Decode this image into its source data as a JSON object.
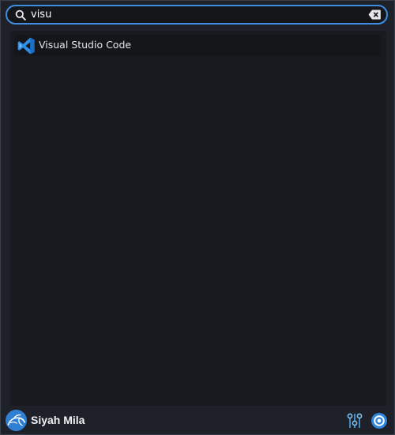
{
  "search": {
    "value": "visu",
    "placeholder": "",
    "search_icon": "search-icon",
    "clear_icon": "clear-text-icon"
  },
  "results": [
    {
      "label": "Visual Studio Code",
      "icon": "vscode-icon",
      "icon_color": "#2c8fe8"
    }
  ],
  "footer": {
    "username": "Siyah Mila",
    "avatar_icon": "kali-dragon-icon",
    "settings_icon": "settings-sliders-icon",
    "power_icon": "power-icon"
  },
  "colors": {
    "accent": "#3d8ee0",
    "background": "#1f2128",
    "list_background": "#181a1f"
  }
}
